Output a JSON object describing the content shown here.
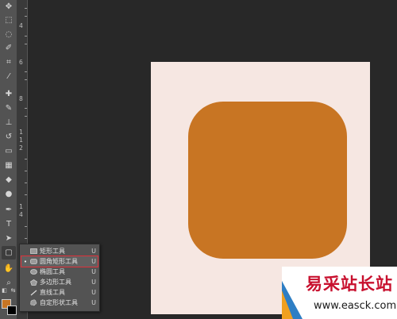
{
  "toolbar": {
    "tools": [
      {
        "name": "move-tool",
        "glyph": "✥"
      },
      {
        "name": "marquee-tool",
        "glyph": "⬚"
      },
      {
        "name": "lasso-tool",
        "glyph": "◌"
      },
      {
        "name": "quick-select-tool",
        "glyph": "✐"
      },
      {
        "name": "crop-tool",
        "glyph": "⌗"
      },
      {
        "name": "eyedropper-tool",
        "glyph": "⁄"
      },
      {
        "name": "healing-brush-tool",
        "glyph": "✚"
      },
      {
        "name": "brush-tool",
        "glyph": "✎"
      },
      {
        "name": "clone-stamp-tool",
        "glyph": "⊥"
      },
      {
        "name": "history-brush-tool",
        "glyph": "↺"
      },
      {
        "name": "eraser-tool",
        "glyph": "▭"
      },
      {
        "name": "gradient-tool",
        "glyph": "▦"
      },
      {
        "name": "blur-tool",
        "glyph": "◆"
      },
      {
        "name": "dodge-tool",
        "glyph": "●"
      },
      {
        "name": "pen-tool",
        "glyph": "✒"
      },
      {
        "name": "type-tool",
        "glyph": "T"
      },
      {
        "name": "path-selection-tool",
        "glyph": "➤"
      },
      {
        "name": "shape-tool",
        "glyph": "▢"
      },
      {
        "name": "hand-tool",
        "glyph": "✋"
      },
      {
        "name": "zoom-tool",
        "glyph": "⌕"
      }
    ],
    "foreground_color": "#c87523",
    "background_color": "#000000"
  },
  "ruler": {
    "labels": [
      "4",
      "6",
      "8",
      "1",
      "1",
      "2",
      "1",
      "4",
      "1",
      "6"
    ]
  },
  "canvas": {
    "background": "#f6e7e2",
    "shape_fill": "#c87523"
  },
  "shape_menu": {
    "items": [
      {
        "label": "矩形工具",
        "shortcut": "U",
        "selected": false,
        "icon": "rectangle-icon"
      },
      {
        "label": "圆角矩形工具",
        "shortcut": "U",
        "selected": true,
        "icon": "rounded-rectangle-icon"
      },
      {
        "label": "椭圆工具",
        "shortcut": "U",
        "selected": false,
        "icon": "ellipse-icon"
      },
      {
        "label": "多边形工具",
        "shortcut": "U",
        "selected": false,
        "icon": "polygon-icon"
      },
      {
        "label": "直线工具",
        "shortcut": "U",
        "selected": false,
        "icon": "line-icon"
      },
      {
        "label": "自定形状工具",
        "shortcut": "U",
        "selected": false,
        "icon": "custom-shape-icon"
      }
    ],
    "bullet": "•",
    "highlight_color": "#e0303a"
  },
  "watermark": {
    "title": "易采站长站",
    "url": "www.easck.com"
  }
}
